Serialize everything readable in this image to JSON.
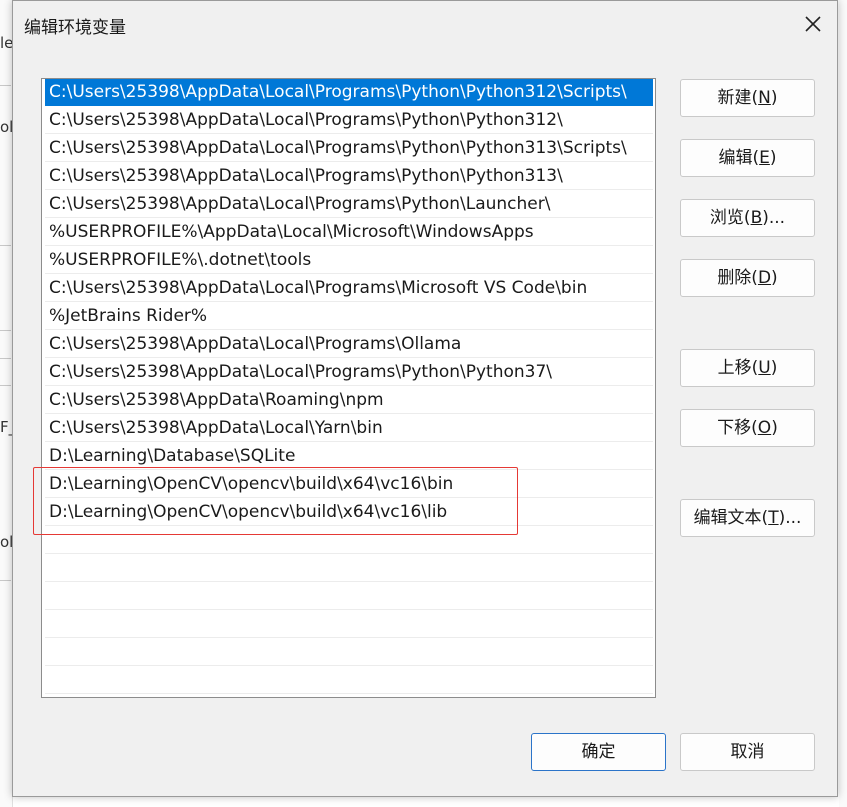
{
  "dialog": {
    "title": "编辑环境变量",
    "close_icon": "close-icon"
  },
  "path_list": [
    "C:\\Users\\25398\\AppData\\Local\\Programs\\Python\\Python312\\Scripts\\",
    "C:\\Users\\25398\\AppData\\Local\\Programs\\Python\\Python312\\",
    "C:\\Users\\25398\\AppData\\Local\\Programs\\Python\\Python313\\Scripts\\",
    "C:\\Users\\25398\\AppData\\Local\\Programs\\Python\\Python313\\",
    "C:\\Users\\25398\\AppData\\Local\\Programs\\Python\\Launcher\\",
    "%USERPROFILE%\\AppData\\Local\\Microsoft\\WindowsApps",
    "%USERPROFILE%\\.dotnet\\tools",
    "C:\\Users\\25398\\AppData\\Local\\Programs\\Microsoft VS Code\\bin",
    "%JetBrains Rider%",
    "C:\\Users\\25398\\AppData\\Local\\Programs\\Ollama",
    "C:\\Users\\25398\\AppData\\Local\\Programs\\Python\\Python37\\",
    "C:\\Users\\25398\\AppData\\Roaming\\npm",
    "C:\\Users\\25398\\AppData\\Local\\Yarn\\bin",
    "D:\\Learning\\Database\\SQLite",
    "D:\\Learning\\OpenCV\\opencv\\build\\x64\\vc16\\bin",
    "D:\\Learning\\OpenCV\\opencv\\build\\x64\\vc16\\lib"
  ],
  "selected_index": 0,
  "buttons": {
    "new": {
      "label": "新建(",
      "key": "N",
      "end": ")"
    },
    "edit": {
      "label": "编辑(",
      "key": "E",
      "end": ")"
    },
    "browse": {
      "label": "浏览(",
      "key": "B",
      "end": ")..."
    },
    "delete": {
      "label": "删除(",
      "key": "D",
      "end": ")"
    },
    "move_up": {
      "label": "上移(",
      "key": "U",
      "end": ")"
    },
    "move_down": {
      "label": "下移(",
      "key": "O",
      "end": ")"
    },
    "edit_text": {
      "label": "编辑文本(",
      "key": "T",
      "end": ")..."
    },
    "ok": "确定",
    "cancel": "取消"
  },
  "colors": {
    "selection": "#0078d7",
    "annotation_box": "#e53935",
    "primary_border": "#2b74c9"
  },
  "background_fragments": [
    "le",
    "ols",
    "F_",
    "ols"
  ]
}
